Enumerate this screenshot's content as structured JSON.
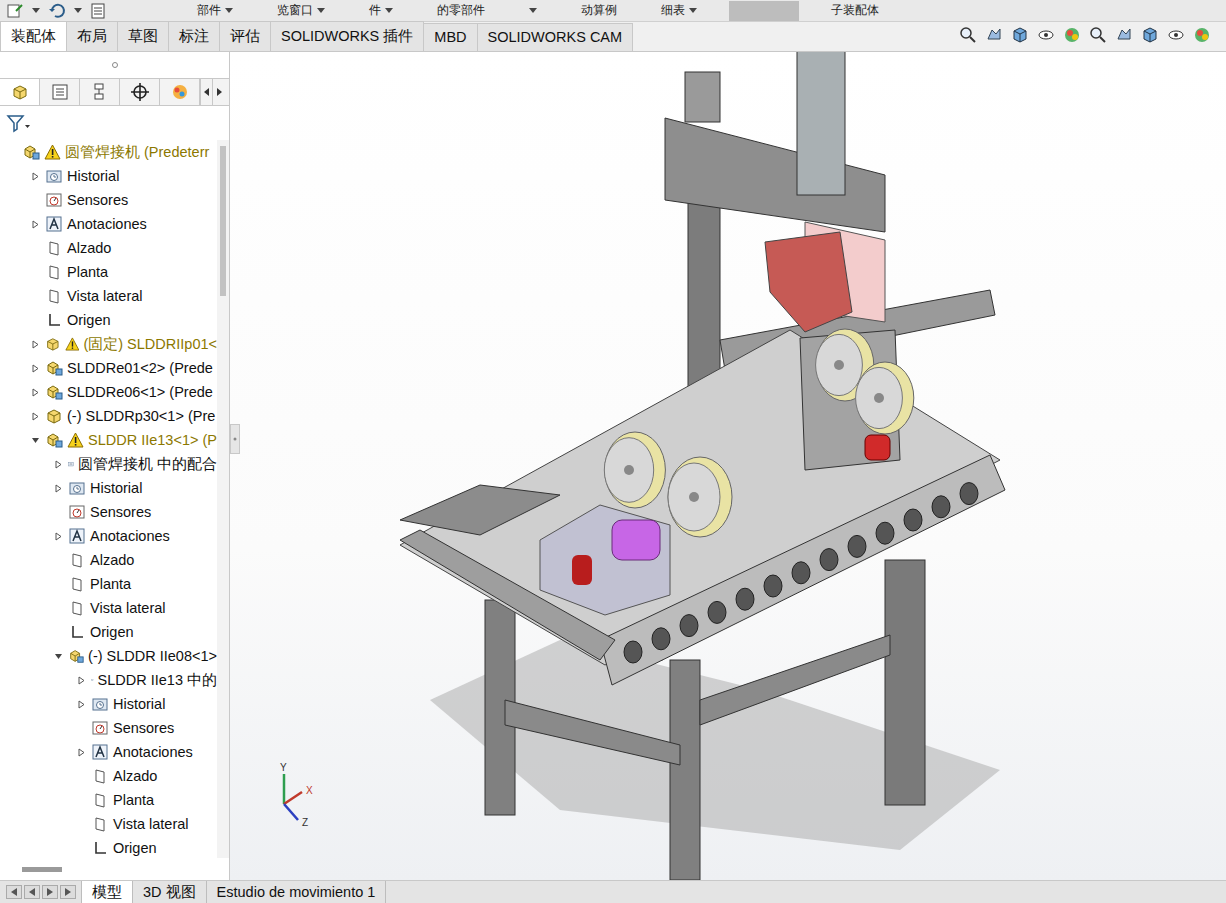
{
  "quick_access": {
    "items": [
      {
        "label": "部件",
        "dropdown": true
      },
      {
        "label": "览窗口",
        "dropdown": true
      },
      {
        "label": "件",
        "dropdown": true
      },
      {
        "label": "的零部件",
        "dropdown": false
      },
      {
        "label": "",
        "dropdown": true
      },
      {
        "label": "动算例",
        "dropdown": false
      },
      {
        "label": "细表",
        "dropdown": true
      },
      {
        "label": "子装配体",
        "dropdown": false
      }
    ]
  },
  "ribbon_tabs": [
    {
      "label": "装配体",
      "selected": true
    },
    {
      "label": "布局",
      "selected": false
    },
    {
      "label": "草图",
      "selected": false
    },
    {
      "label": "标注",
      "selected": false
    },
    {
      "label": "评估",
      "selected": false
    },
    {
      "label": "SOLIDWORKS 插件",
      "selected": false
    },
    {
      "label": "MBD",
      "selected": false
    },
    {
      "label": "SOLIDWORKS CAM",
      "selected": false
    }
  ],
  "panel_tabs": [
    {
      "kind": "feature-manager",
      "selected": true
    },
    {
      "kind": "property-manager",
      "selected": false
    },
    {
      "kind": "configuration-manager",
      "selected": false
    },
    {
      "kind": "dimxpert-manager",
      "selected": false
    },
    {
      "kind": "display-manager",
      "selected": false
    }
  ],
  "feature_tree": {
    "items": [
      {
        "label": "圆管焊接机  (Predeterr",
        "level": 0,
        "kind": "assembly",
        "expander": "none",
        "warning": true
      },
      {
        "label": "Historial",
        "level": 1,
        "kind": "history",
        "expander": "collapsed",
        "warning": false
      },
      {
        "label": "Sensores",
        "level": 1,
        "kind": "sensor",
        "expander": "none",
        "warning": false
      },
      {
        "label": "Anotaciones",
        "level": 1,
        "kind": "annotation",
        "expander": "collapsed",
        "warning": false
      },
      {
        "label": "Alzado",
        "level": 1,
        "kind": "plane",
        "expander": "none",
        "warning": false
      },
      {
        "label": "Planta",
        "level": 1,
        "kind": "plane",
        "expander": "none",
        "warning": false
      },
      {
        "label": "Vista lateral",
        "level": 1,
        "kind": "plane",
        "expander": "none",
        "warning": false
      },
      {
        "label": "Origen",
        "level": 1,
        "kind": "origin",
        "expander": "none",
        "warning": false
      },
      {
        "label": "(固定) SLDDRIIp01<",
        "level": 1,
        "kind": "part",
        "expander": "collapsed",
        "warning": true
      },
      {
        "label": "SLDDRe01<2> (Prede",
        "level": 1,
        "kind": "assembly",
        "expander": "collapsed",
        "warning": false
      },
      {
        "label": "SLDDRe06<1> (Prede",
        "level": 1,
        "kind": "assembly",
        "expander": "collapsed",
        "warning": false
      },
      {
        "label": "(-) SLDDRp30<1> (Pre",
        "level": 1,
        "kind": "part",
        "expander": "collapsed",
        "warning": false
      },
      {
        "label": "SLDDR IIe13<1> (P",
        "level": 1,
        "kind": "assembly",
        "expander": "expanded",
        "warning": true
      },
      {
        "label": "圆管焊接机 中的配合",
        "level": 2,
        "kind": "mates",
        "expander": "collapsed",
        "warning": false
      },
      {
        "label": "Historial",
        "level": 2,
        "kind": "history",
        "expander": "collapsed",
        "warning": false
      },
      {
        "label": "Sensores",
        "level": 2,
        "kind": "sensor",
        "expander": "none",
        "warning": false
      },
      {
        "label": "Anotaciones",
        "level": 2,
        "kind": "annotation",
        "expander": "collapsed",
        "warning": false
      },
      {
        "label": "Alzado",
        "level": 2,
        "kind": "plane",
        "expander": "none",
        "warning": false
      },
      {
        "label": "Planta",
        "level": 2,
        "kind": "plane",
        "expander": "none",
        "warning": false
      },
      {
        "label": "Vista lateral",
        "level": 2,
        "kind": "plane",
        "expander": "none",
        "warning": false
      },
      {
        "label": "Origen",
        "level": 2,
        "kind": "origin",
        "expander": "none",
        "warning": false
      },
      {
        "label": "(-) SLDDR IIe08<1>",
        "level": 2,
        "kind": "assembly",
        "expander": "expanded",
        "warning": false
      },
      {
        "label": "SLDDR IIe13 中的",
        "level": 3,
        "kind": "mates",
        "expander": "collapsed",
        "warning": false
      },
      {
        "label": "Historial",
        "level": 3,
        "kind": "history",
        "expander": "collapsed",
        "warning": false
      },
      {
        "label": "Sensores",
        "level": 3,
        "kind": "sensor",
        "expander": "none",
        "warning": false
      },
      {
        "label": "Anotaciones",
        "level": 3,
        "kind": "annotation",
        "expander": "collapsed",
        "warning": false
      },
      {
        "label": "Alzado",
        "level": 3,
        "kind": "plane",
        "expander": "none",
        "warning": false
      },
      {
        "label": "Planta",
        "level": 3,
        "kind": "plane",
        "expander": "none",
        "warning": false
      },
      {
        "label": "Vista lateral",
        "level": 3,
        "kind": "plane",
        "expander": "none",
        "warning": false
      },
      {
        "label": "Origen",
        "level": 3,
        "kind": "origin",
        "expander": "none",
        "warning": false
      }
    ]
  },
  "bottom_tabs": [
    {
      "label": "模型",
      "selected": true
    },
    {
      "label": "3D 视图",
      "selected": false
    },
    {
      "label": "Estudio de movimiento 1",
      "selected": false
    }
  ],
  "triad": {
    "x": "X",
    "y": "Y",
    "z": "Z"
  }
}
